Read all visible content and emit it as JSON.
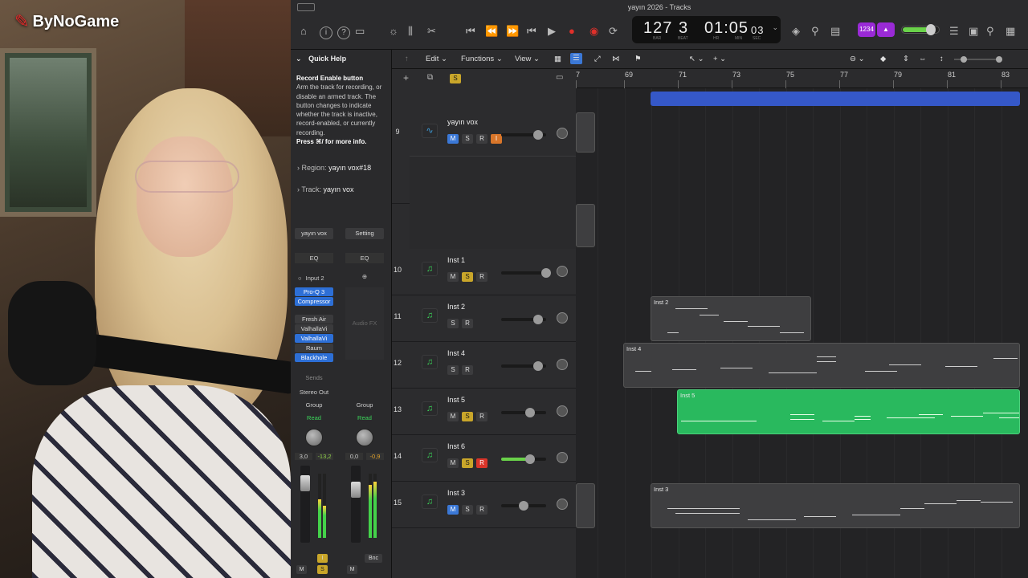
{
  "overlay": {
    "logo_text": "ByNoGame"
  },
  "window": {
    "title": "yayın 2026 - Tracks"
  },
  "lcd": {
    "bar": "127",
    "beat": "3",
    "time": "01:05",
    "time_sub": "03",
    "bar_label": "BAR",
    "beat_label": "BEAT",
    "hr_label": "HR",
    "min_label": "MIN",
    "sec_label": "SEC"
  },
  "controlbar": {
    "badge1": "1234",
    "badge2": "▲"
  },
  "toolbar": {
    "edit": "Edit",
    "functions": "Functions",
    "view": "View"
  },
  "quickhelp": {
    "header": "Quick Help",
    "title": "Record Enable button",
    "body": "Arm the track for recording, or disable an armed track. The button changes to indicate whether the track is inactive, record-enabled, or currently recording.",
    "more": "Press ⌘/ for more info."
  },
  "inspector": {
    "region_label": "Region:",
    "region_value": "yayın vox#18",
    "track_label": "Track:",
    "track_value": "yayın vox"
  },
  "strip1": {
    "name": "yayın vox",
    "eq": "EQ",
    "input": "Input 2",
    "plugins": [
      "Pro-Q 3",
      "Compressor",
      "Fresh Air",
      "ValhallaVi",
      "ValhallaVi",
      "Raum",
      "Blackhole"
    ],
    "sends": "Sends",
    "output": "Stereo Out",
    "group": "Group",
    "read": "Read",
    "pan_val": "3,0",
    "peak_val": "-13,2",
    "m": "M",
    "s": "S"
  },
  "strip2": {
    "name": "Setting",
    "eq": "EQ",
    "audio_fx": "Audio FX",
    "group": "Group",
    "read": "Read",
    "pan_val": "0,0",
    "peak_val": "-0,9",
    "bnc": "Bnc",
    "m": "M"
  },
  "ruler": {
    "bars": [
      "7",
      "69",
      "71",
      "73",
      "75",
      "77",
      "79",
      "81",
      "83"
    ]
  },
  "tracks": [
    {
      "num": "9",
      "name": "yayın vox",
      "type": "audio",
      "m": "M",
      "s": "S",
      "r": "R",
      "i": "I"
    },
    {
      "num": "10",
      "name": "Inst 1",
      "type": "inst",
      "m": "M",
      "s": "S",
      "r": "R"
    },
    {
      "num": "11",
      "name": "Inst 2",
      "type": "inst",
      "s": "S",
      "r": "R"
    },
    {
      "num": "12",
      "name": "Inst 4",
      "type": "inst",
      "s": "S",
      "r": "R"
    },
    {
      "num": "13",
      "name": "Inst 5",
      "type": "inst",
      "m": "M",
      "s": "S",
      "r": "R"
    },
    {
      "num": "14",
      "name": "Inst 6",
      "type": "inst",
      "m": "M",
      "s": "S",
      "r": "R"
    },
    {
      "num": "15",
      "name": "Inst 3",
      "type": "inst",
      "m": "M",
      "s": "S",
      "r": "R"
    }
  ],
  "regions": {
    "inst2": "Inst 2",
    "inst4": "Inst 4",
    "inst5": "Inst 5",
    "inst3": "Inst 3"
  },
  "colors": {
    "accent": "#3b78d6",
    "record": "#d9352a",
    "solo": "#c9a62a",
    "midi_green": "#29b95e",
    "region_blue": "#3558c8"
  }
}
